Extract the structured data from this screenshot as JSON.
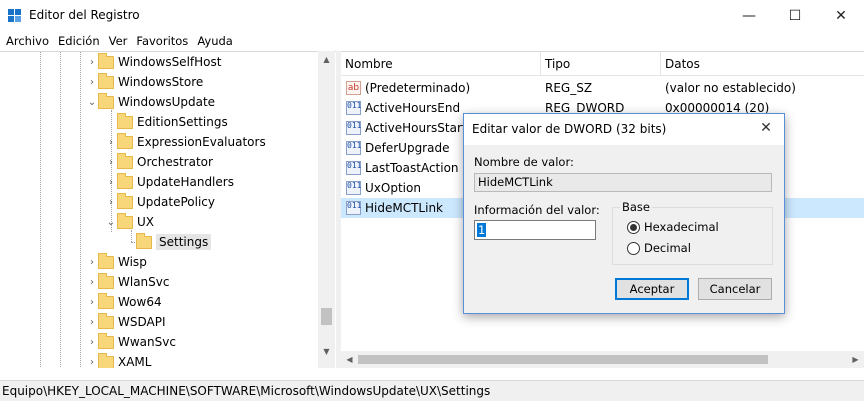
{
  "window": {
    "title": "Editor del Registro",
    "minimize_glyph": "—",
    "maximize_glyph": "☐",
    "close_glyph": "✕"
  },
  "menu": [
    "Archivo",
    "Edición",
    "Ver",
    "Favoritos",
    "Ayuda"
  ],
  "tree": {
    "items": [
      {
        "label": "WindowsSelfHost",
        "expander": "›"
      },
      {
        "label": "WindowsStore",
        "expander": "›"
      },
      {
        "label": "WindowsUpdate",
        "expander": "⌄"
      },
      {
        "label": "EditionSettings",
        "expander": ""
      },
      {
        "label": "ExpressionEvaluators",
        "expander": "›"
      },
      {
        "label": "Orchestrator",
        "expander": "›"
      },
      {
        "label": "UpdateHandlers",
        "expander": "›"
      },
      {
        "label": "UpdatePolicy",
        "expander": "›"
      },
      {
        "label": "UX",
        "expander": "⌄"
      },
      {
        "label": "Settings",
        "expander": ""
      },
      {
        "label": "Wisp",
        "expander": "›"
      },
      {
        "label": "WlanSvc",
        "expander": "›"
      },
      {
        "label": "Wow64",
        "expander": "›"
      },
      {
        "label": "WSDAPI",
        "expander": "›"
      },
      {
        "label": "WwanSvc",
        "expander": "›"
      },
      {
        "label": "XAML",
        "expander": "›"
      }
    ]
  },
  "list": {
    "headers": {
      "name": "Nombre",
      "type": "Tipo",
      "data": "Datos"
    },
    "rows": [
      {
        "icon": "ab",
        "name": "(Predeterminado)",
        "type": "REG_SZ",
        "data": "(valor no establecido)"
      },
      {
        "icon": "011",
        "name": "ActiveHoursEnd",
        "type": "REG_DWORD",
        "data": "0x00000014 (20)"
      },
      {
        "icon": "011",
        "name": "ActiveHoursStart",
        "type": "",
        "data": ""
      },
      {
        "icon": "011",
        "name": "DeferUpgrade",
        "type": "",
        "data": ""
      },
      {
        "icon": "011",
        "name": "LastToastAction",
        "type": "",
        "data": ""
      },
      {
        "icon": "011",
        "name": "UxOption",
        "type": "",
        "data": ""
      },
      {
        "icon": "011",
        "name": "HideMCTLink",
        "type": "",
        "data": ""
      }
    ]
  },
  "statusbar": {
    "path": "Equipo\\HKEY_LOCAL_MACHINE\\SOFTWARE\\Microsoft\\WindowsUpdate\\UX\\Settings"
  },
  "dialog": {
    "title": "Editar valor de DWORD (32 bits)",
    "name_label": "Nombre de valor:",
    "name_value": "HideMCTLink",
    "data_label": "Información del valor:",
    "data_value": "1",
    "base_label": "Base",
    "hex_label": "Hexadecimal",
    "dec_label": "Decimal",
    "ok_label": "Aceptar",
    "cancel_label": "Cancelar"
  }
}
